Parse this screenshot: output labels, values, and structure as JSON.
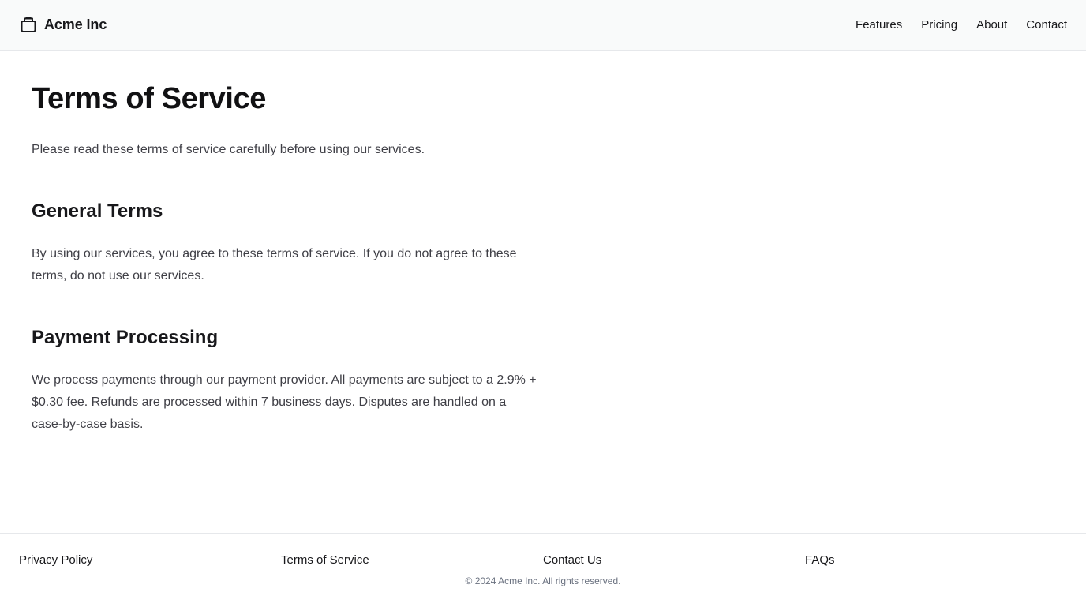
{
  "header": {
    "brand_name": "Acme Inc",
    "brand_icon": "package-icon",
    "nav": [
      {
        "label": "Features"
      },
      {
        "label": "Pricing"
      },
      {
        "label": "About"
      },
      {
        "label": "Contact"
      }
    ]
  },
  "main": {
    "title": "Terms of Service",
    "intro": "Please read these terms of service carefully before using our services.",
    "sections": [
      {
        "heading": "General Terms",
        "body": "By using our services, you agree to these terms of service. If you do not agree to these terms, do not use our services."
      },
      {
        "heading": "Payment Processing",
        "body": "We process payments through our payment provider. All payments are subject to a 2.9% + $0.30 fee. Refunds are processed within 7 business days. Disputes are handled on a case-by-case basis."
      }
    ]
  },
  "footer": {
    "links": [
      {
        "label": "Privacy Policy"
      },
      {
        "label": "Terms of Service"
      },
      {
        "label": "Contact Us"
      },
      {
        "label": "FAQs"
      }
    ],
    "copyright": "© 2024 Acme Inc. All rights reserved."
  },
  "colors": {
    "header_background": "#f9fafa",
    "text_primary": "#18181b",
    "text_body": "#3f3f46",
    "text_muted": "#6b7280",
    "border": "#e6e8eb"
  }
}
